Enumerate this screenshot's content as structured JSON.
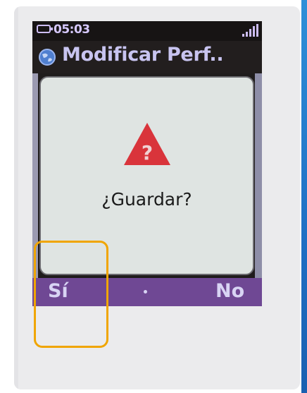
{
  "status_bar": {
    "time": "05:03",
    "battery_icon": "battery-icon",
    "signal_icon": "signal-strength-icon"
  },
  "header": {
    "icon": "globe-icon",
    "title": "Modificar Perf.."
  },
  "dialog": {
    "icon": "warning-question-icon",
    "message": "¿Guardar?"
  },
  "softkeys": {
    "left_label": "Sí",
    "center_icon": "center-dot-icon",
    "right_label": "No"
  },
  "colors": {
    "softkey_bar": "#6f4894",
    "warning_red": "#d9343b",
    "highlight": "#f0a500",
    "accent_blue": "#1f6fc4"
  }
}
